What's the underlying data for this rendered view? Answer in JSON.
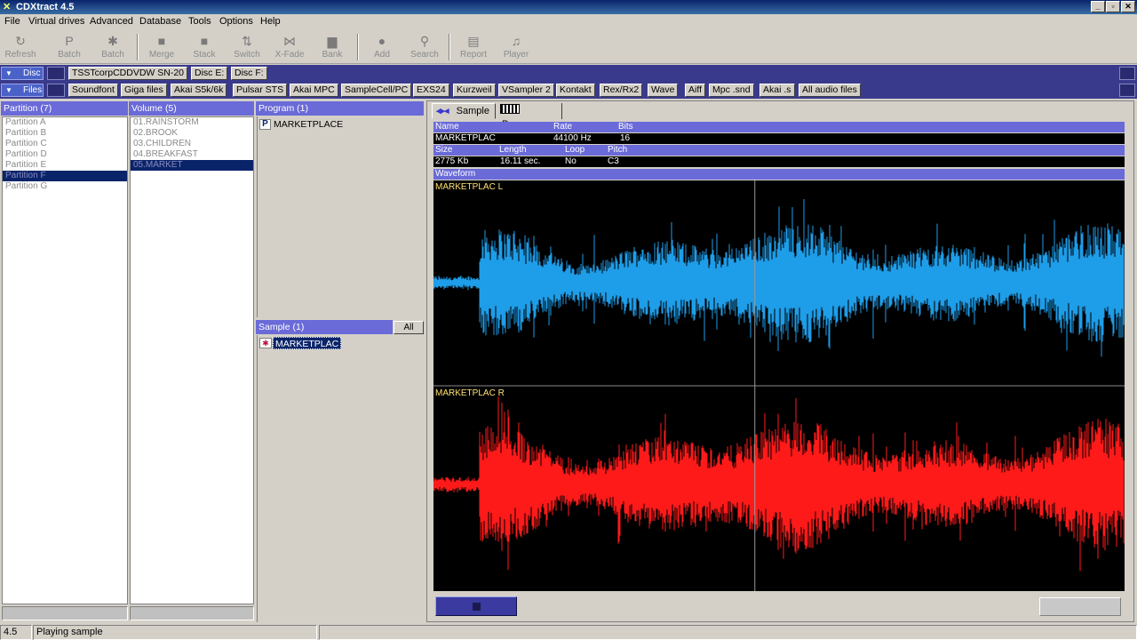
{
  "window": {
    "title": "CDXtract 4.5",
    "controls": [
      "_",
      "▫",
      "✕"
    ]
  },
  "menu": [
    "File",
    "Virtual drives",
    "Advanced",
    "Database",
    "Tools",
    "Options",
    "Help"
  ],
  "toolbar": [
    {
      "label": "Refresh",
      "icon": "refresh-icon",
      "glyph": "↻"
    },
    {
      "label": "Batch",
      "icon": "batch-p-icon",
      "glyph": "P"
    },
    {
      "label": "Batch",
      "icon": "batch-gear-icon",
      "glyph": "✱"
    },
    {
      "label": "Merge",
      "icon": "merge-icon",
      "glyph": "■"
    },
    {
      "label": "Stack",
      "icon": "stack-icon",
      "glyph": "■"
    },
    {
      "label": "Switch",
      "icon": "switch-icon",
      "glyph": "⇅"
    },
    {
      "label": "X-Fade",
      "icon": "xfade-icon",
      "glyph": "⋈"
    },
    {
      "label": "Bank",
      "icon": "bank-icon",
      "glyph": "▆"
    },
    {
      "label": "Add",
      "icon": "add-icon",
      "glyph": "●"
    },
    {
      "label": "Search",
      "icon": "search-icon",
      "glyph": "⚲"
    },
    {
      "label": "Report",
      "icon": "report-icon",
      "glyph": "▤"
    },
    {
      "label": "Player",
      "icon": "player-icon",
      "glyph": "♫"
    }
  ],
  "disc": {
    "label": "Disc",
    "drives": [
      "TSSTcorpCDDVDW SN-20",
      "Disc E:",
      "Disc F:"
    ]
  },
  "files": {
    "label": "Files",
    "formats": [
      "Soundfont",
      "Giga files",
      "Akai S5k/6k",
      "Pulsar STS",
      "Akai MPC",
      "SampleCell/PC",
      "EXS24",
      "Kurzweil",
      "VSampler 2",
      "Kontakt",
      "Rex/Rx2",
      "Wave",
      "Aiff",
      "Mpc .snd",
      "Akai .s",
      "All audio files"
    ]
  },
  "partition": {
    "header": "Partition (7)",
    "items": [
      "Partition A",
      "Partition B",
      "Partition C",
      "Partition D",
      "Partition E",
      "Partition F",
      "Partition G"
    ],
    "selected_index": 5
  },
  "volume": {
    "header": "Volume (5)",
    "items": [
      "01.RAINSTORM",
      "02.BROOK",
      "03.CHILDREN",
      "04.BREAKFAST",
      "05.MARKET"
    ],
    "selected_index": 4
  },
  "program": {
    "header": "Program (1)",
    "items": [
      "MARKETPLACE"
    ]
  },
  "sample": {
    "header": "Sample (1)",
    "all_button": "All",
    "items": [
      "MARKETPLAC"
    ]
  },
  "tabs": [
    "Sample",
    "Program"
  ],
  "info": {
    "name_label": "Name",
    "name_value": "MARKETPLAC",
    "rate_label": "Rate",
    "rate_value": "44100 Hz",
    "bits_label": "Bits",
    "bits_value": "16",
    "size_label": "Size",
    "size_value": "2775 Kb",
    "length_label": "Length",
    "length_value": "16.11 sec.",
    "loop_label": "Loop",
    "loop_value": "No",
    "pitch_label": "Pitch",
    "pitch_value": "C3",
    "waveform_label": "Waveform"
  },
  "waveform": {
    "left_label": "MARKETPLAC L",
    "right_label": "MARKETPLAC R",
    "left_color": "#1e9de8",
    "right_color": "#ff1a1a",
    "playhead_fraction": 0.465
  },
  "status": {
    "version": "4.5",
    "message": "Playing sample"
  }
}
